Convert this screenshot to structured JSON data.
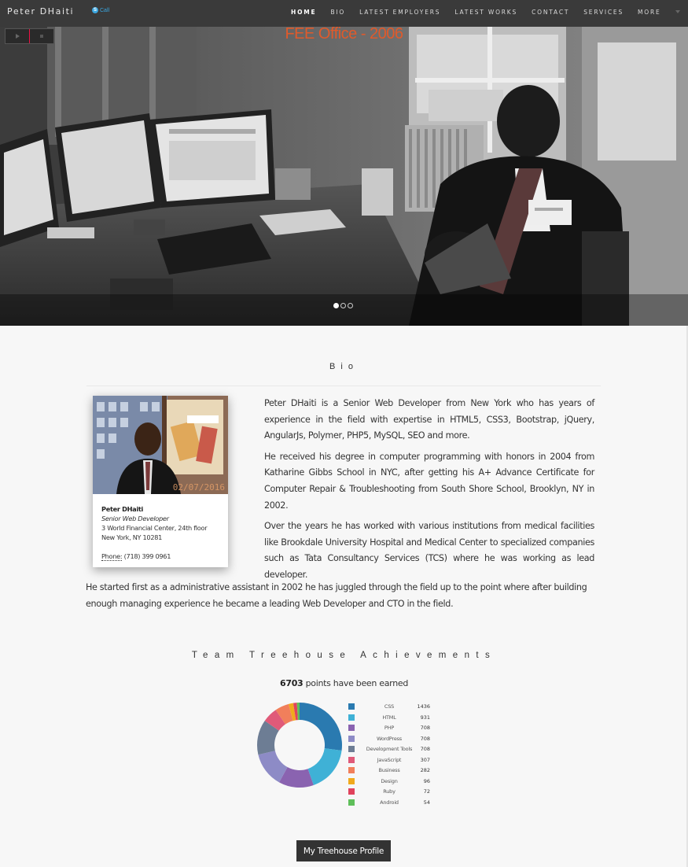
{
  "nav": {
    "brand": "Peter DHaiti",
    "skype_label": "Call",
    "items": [
      {
        "label": "HOME",
        "active": true
      },
      {
        "label": "BIO",
        "active": false
      },
      {
        "label": "LATEST EMPLOYERS",
        "active": false
      },
      {
        "label": "LATEST WORKS",
        "active": false
      },
      {
        "label": "CONTACT",
        "active": false
      },
      {
        "label": "SERVICES",
        "active": false
      },
      {
        "label": "MORE",
        "active": false
      }
    ]
  },
  "hero": {
    "caption": "FEE Office - 2006",
    "slides_count": 3,
    "active_slide": 1,
    "caption_color": "#e05a2b"
  },
  "bio": {
    "title": "Bio",
    "card": {
      "photo_date": "02/07/2016",
      "name": "Peter DHaiti",
      "role": "Senior Web Developer",
      "address1": "3 World Financial Center, 24th floor",
      "address2": "New York, NY 10281",
      "phone_label": "Phone:",
      "phone": "(718) 399 0961"
    },
    "paragraphs": [
      "Peter DHaiti is a Senior Web Developer from New York who has years of experience in the field with expertise in HTML5, CSS3, Bootstrap, jQuery, AngularJs, Polymer, PHP5, MySQL, SEO and more.",
      "He received his degree in computer programming with honors in 2004 from Katharine Gibbs School in NYC, after getting his A+ Advance Certificate for Computer Repair & Troubleshooting from South Shore School, Brooklyn, NY in 2002.",
      "Over the years he has worked with various institutions from medical facilities like Brookdale University Hospital and Medical Center to specialized companies such as Tata Consultancy Services (TCS) where he was working as lead developer."
    ],
    "closing": "He started first as a administrative assistant in 2002 he has juggled through the field up to the point where after building enough managing experience he became a leading Web Developer and CTO in the field."
  },
  "achievements": {
    "title": "Team Treehouse Achievements",
    "points_value": "6703",
    "points_suffix": " points have been earned",
    "button_label": "My Treehouse Profile"
  },
  "chart_data": {
    "type": "pie",
    "categories": [
      "CSS",
      "HTML",
      "PHP",
      "WordPress",
      "Development Tools",
      "JavaScript",
      "Business",
      "Design",
      "Ruby",
      "Android"
    ],
    "values": [
      1436,
      931,
      708,
      708,
      708,
      307,
      282,
      96,
      72,
      54
    ],
    "colors": [
      "#2a7ab0",
      "#3fb1d6",
      "#8a63b0",
      "#8d8bc6",
      "#6d7d94",
      "#e05a79",
      "#f17f5b",
      "#f0a91c",
      "#e0435c",
      "#5fbf5a"
    ],
    "legend": "right"
  }
}
